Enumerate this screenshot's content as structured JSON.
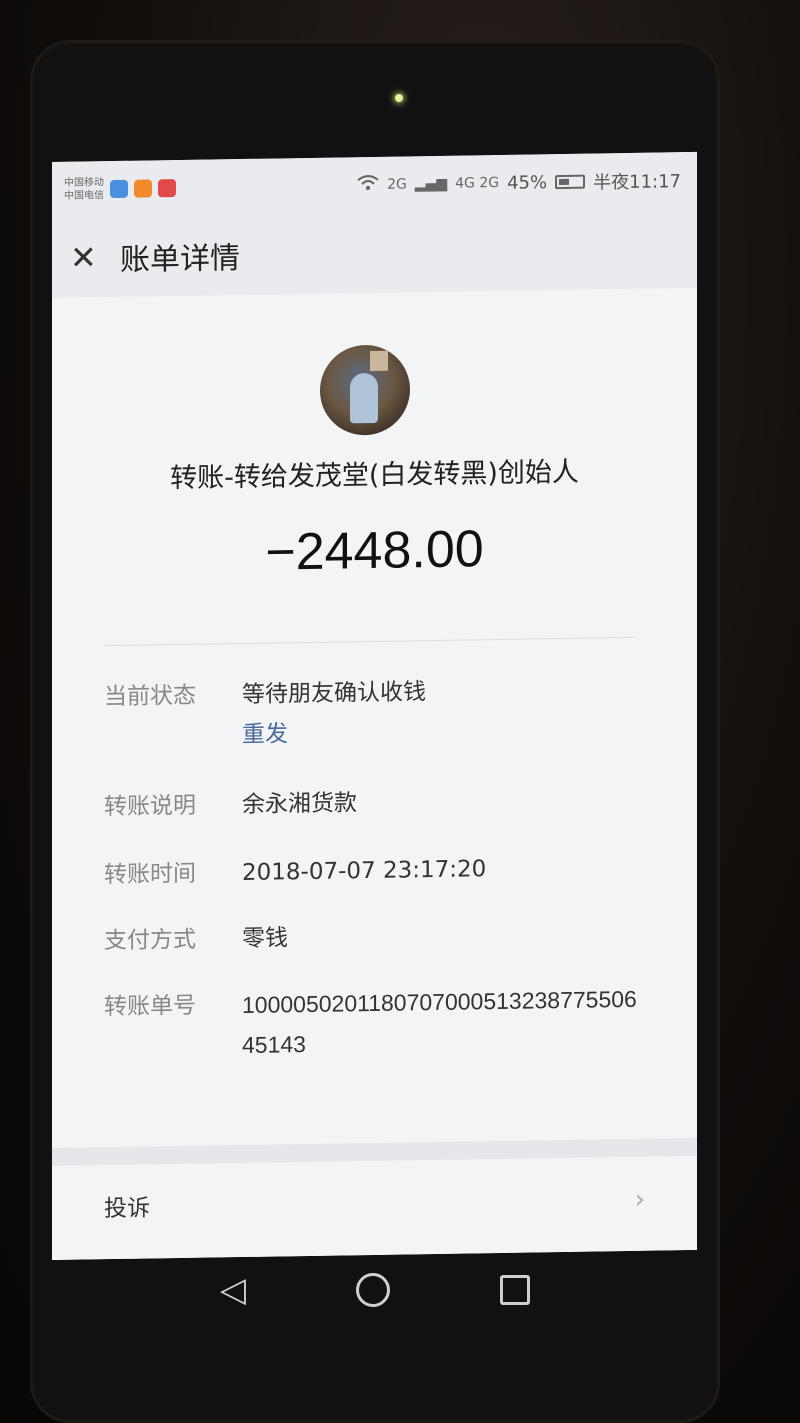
{
  "status_bar": {
    "carrier1": "中国移动",
    "carrier2": "中国电信",
    "signal_2g": "2G",
    "signal_4g": "4G 2G",
    "battery": "45%",
    "time": "半夜11:17",
    "icons": [
      "wifi-icon",
      "signal-icon",
      "battery-icon"
    ]
  },
  "header": {
    "close_icon": "close-icon",
    "title": "账单详情"
  },
  "transfer": {
    "payee": "转账-转给发茂堂(白发转黑)创始人",
    "amount": "−2448.00"
  },
  "details": {
    "status_label": "当前状态",
    "status_value": "等待朋友确认收钱",
    "resend": "重发",
    "note_label": "转账说明",
    "note_value": "余永湘货款",
    "time_label": "转账时间",
    "time_value": "2018-07-07 23:17:20",
    "method_label": "支付方式",
    "method_value": "零钱",
    "order_label": "转账单号",
    "order_value": "100005020118070700051323877550645143"
  },
  "complain": {
    "label": "投诉",
    "chevron": "›"
  },
  "system_nav": {
    "back": "◁",
    "icons": [
      "back-icon",
      "home-icon",
      "recent-apps-icon"
    ]
  },
  "colors": {
    "accent_link": "#4a6a99",
    "screen_bg": "#f3f4f6"
  }
}
